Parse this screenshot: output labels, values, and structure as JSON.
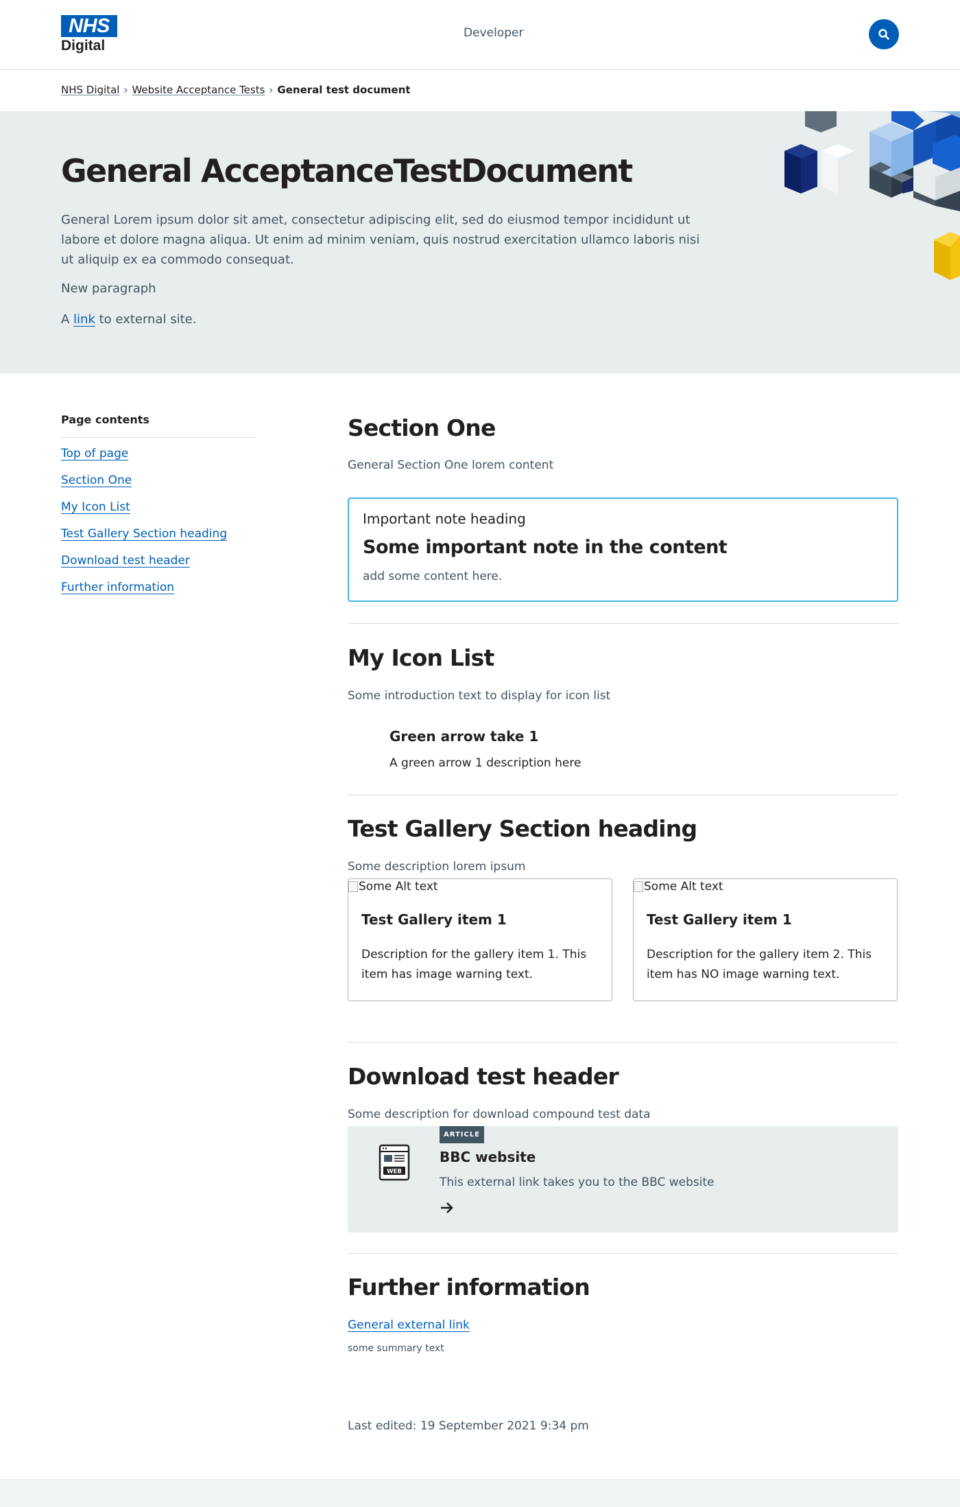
{
  "header": {
    "logo_top": "NHS",
    "logo_bottom": "Digital",
    "nav_label": "Developer",
    "search_icon": "search-icon"
  },
  "breadcrumb": {
    "items": [
      "NHS Digital",
      "Website Acceptance Tests"
    ],
    "current": "General test document"
  },
  "hero": {
    "title": "General AcceptanceTestDocument",
    "body": "General Lorem ipsum dolor sit amet, consectetur adipiscing elit, sed do eiusmod tempor incididunt ut labore et dolore magna aliqua. Ut enim ad minim veniam, quis nostrud exercitation ullamco laboris nisi ut aliquip ex ea commodo consequat.",
    "p2": "New paragraph",
    "p3_prefix": "A ",
    "p3_link": "link",
    "p3_suffix": " to external site.",
    "background": "#e8edee"
  },
  "toc": {
    "title": "Page contents",
    "items": [
      "Top of page",
      "Section One",
      "My Icon List",
      "Test Gallery Section heading",
      "Download test header",
      "Further information"
    ]
  },
  "section_one": {
    "heading": "Section One",
    "text": "General Section One lorem content",
    "note": {
      "label": "Important note heading",
      "heading": "Some important note in the content",
      "body": "add some content here.",
      "border_color": "#41b6e6"
    }
  },
  "icon_list": {
    "heading": "My Icon List",
    "intro": "Some introduction text to display for icon list",
    "items": [
      {
        "title": "Green arrow take 1",
        "desc": "A green arrow 1 description here"
      }
    ]
  },
  "gallery": {
    "heading": "Test Gallery Section heading",
    "desc": "Some description lorem ipsum",
    "items": [
      {
        "alt": "Some Alt text",
        "title": "Test Gallery item 1",
        "desc": "Description for the gallery item 1.  This item has image warning text."
      },
      {
        "alt": "Some Alt text",
        "title": "Test Gallery item 1",
        "desc": "Description for the gallery item 2.   This item has NO image warning text."
      }
    ]
  },
  "download": {
    "heading": "Download test header",
    "desc": "Some description for download compound test data",
    "card": {
      "badge": "ARTICLE",
      "icon": "web-page-icon",
      "icon_label": "WEB",
      "title": "BBC website",
      "desc": "This external link takes you to the BBC website",
      "arrow": "arrow-right-icon"
    }
  },
  "further": {
    "heading": "Further information",
    "link": "General external link",
    "summary": "some summary text"
  },
  "footer": {
    "last_edited": "Last edited: 19 September 2021 9:34 pm"
  },
  "colors": {
    "brand_blue": "#005eb8",
    "text": "#231f20",
    "secondary_text": "#425563"
  }
}
